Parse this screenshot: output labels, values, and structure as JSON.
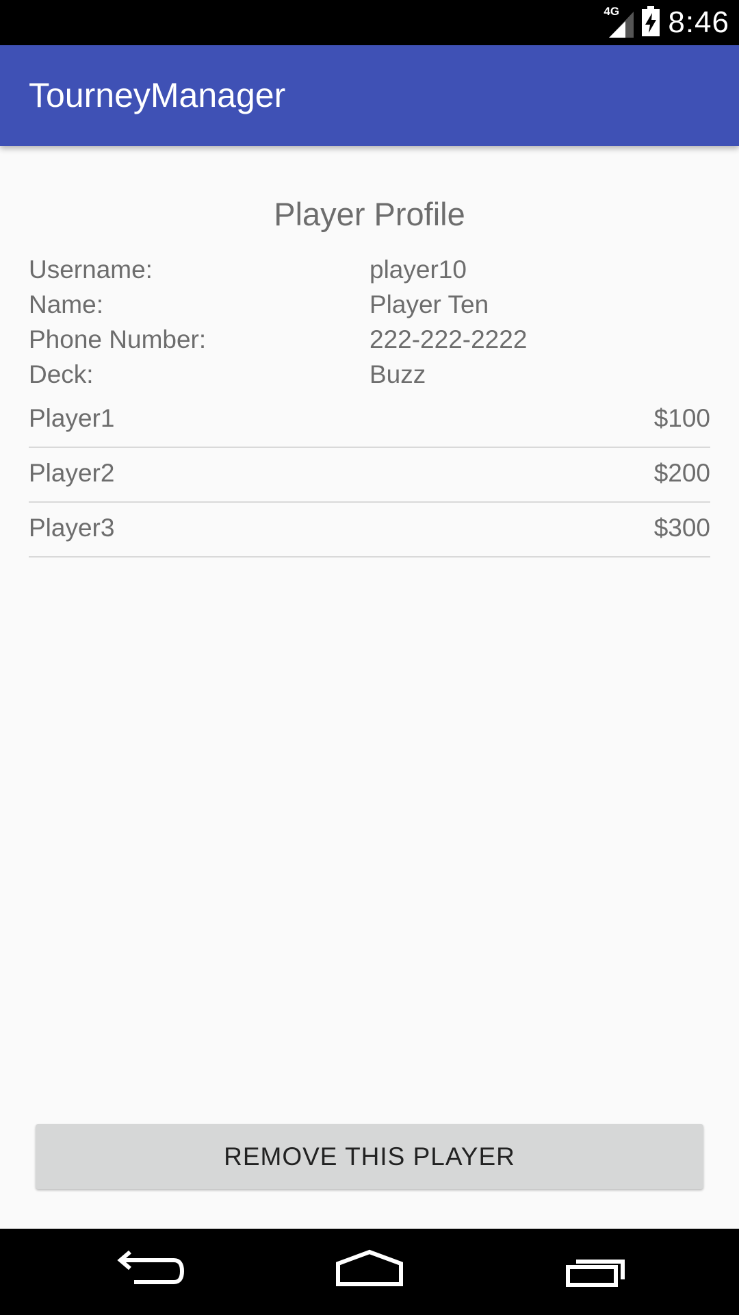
{
  "status_bar": {
    "network": "4G",
    "time": "8:46",
    "icons": [
      "signal-icon",
      "battery-charging-icon"
    ]
  },
  "app_bar": {
    "title": "TourneyManager"
  },
  "profile": {
    "heading": "Player Profile",
    "fields": [
      {
        "label": "Username:",
        "value": "player10"
      },
      {
        "label": "Name:",
        "value": "Player Ten"
      },
      {
        "label": "Phone Number:",
        "value": "222-222-2222"
      },
      {
        "label": "Deck:",
        "value": "Buzz"
      }
    ]
  },
  "prizes": [
    {
      "name": "Player1",
      "amount": "$100"
    },
    {
      "name": "Player2",
      "amount": "$200"
    },
    {
      "name": "Player3",
      "amount": "$300"
    }
  ],
  "actions": {
    "remove_label": "REMOVE THIS PLAYER"
  },
  "nav_bar": {
    "icons": [
      "back-icon",
      "home-icon",
      "recents-icon"
    ]
  },
  "colors": {
    "primary": "#3f51b5",
    "background": "#fafafa",
    "text": "#6d6d6d",
    "button": "#d6d7d7"
  }
}
